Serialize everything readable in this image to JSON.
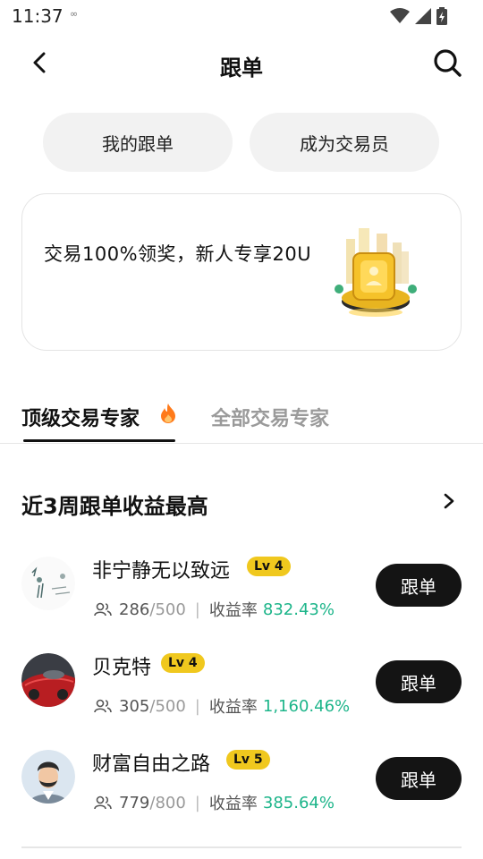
{
  "status": {
    "time": "11:37",
    "ext_glyph": "∞"
  },
  "nav": {
    "title": "跟单"
  },
  "pills": [
    {
      "label": "我的跟单"
    },
    {
      "label": "成为交易员"
    }
  ],
  "promo": {
    "text": "交易100%领奖，新人专享20U",
    "image": "gold-coin-buildings-illustration"
  },
  "tabs": [
    {
      "label": "顶级交易专家",
      "active": true
    },
    {
      "label": "全部交易专家",
      "active": false
    }
  ],
  "section": {
    "title": "近3周跟单收益最高"
  },
  "rate_label": "收益率",
  "follow_label": "跟单",
  "traders": [
    {
      "name": "非宁静无以致远",
      "level": "Lv 4",
      "followers": "286",
      "capacity": "500",
      "rate": "832.43%"
    },
    {
      "name": "贝克特",
      "level": "Lv 4",
      "followers": "305",
      "capacity": "500",
      "rate": "1,160.46%"
    },
    {
      "name": "财富自由之路",
      "level": "Lv 5",
      "followers": "779",
      "capacity": "800",
      "rate": "385.64%"
    }
  ],
  "colors": {
    "accent_green": "#1db58a",
    "badge_yellow": "#f0c81e",
    "button_dark": "#141414"
  }
}
